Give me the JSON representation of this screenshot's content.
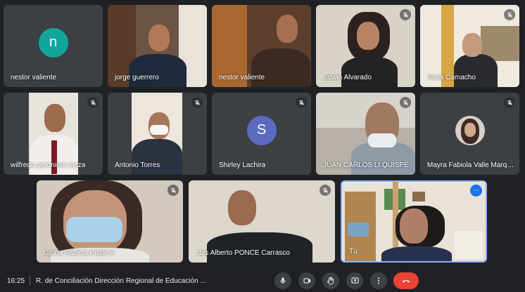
{
  "participants": [
    {
      "name": "nestor valiente",
      "initial": "n",
      "avatar_color": "#12a59c",
      "muted": false,
      "camera": false
    },
    {
      "name": "jorge guerrero",
      "muted": false,
      "camera": true
    },
    {
      "name": "nestor valiente",
      "muted": false,
      "camera": true
    },
    {
      "name": "Edwin Alvarado",
      "muted": true,
      "camera": true
    },
    {
      "name": "Rosa Camacho",
      "muted": true,
      "camera": true
    },
    {
      "name": "wilfredo geronimo meza",
      "muted": true,
      "camera": true
    },
    {
      "name": "Antonio Torres",
      "muted": true,
      "camera": true
    },
    {
      "name": "Shirley Lachira",
      "initial": "S",
      "avatar_color": "#5c6bc0",
      "muted": true,
      "camera": false
    },
    {
      "name": "JUAN CARLOS LI QUISPE",
      "muted": true,
      "camera": true
    },
    {
      "name": "Mayra Fabiola Valle Marqu...",
      "muted": true,
      "camera": false
    },
    {
      "name": "Gloria Patricia Prialé F.",
      "muted": true,
      "camera": true
    },
    {
      "name": "Luis Alberto PONCE Carrasco",
      "muted": true,
      "camera": true
    },
    {
      "name": "Tú",
      "muted": false,
      "camera": true,
      "self": true
    }
  ],
  "bottom_bar": {
    "time": "16:25",
    "separator": "|",
    "meeting_title": "R. de Conciliación Dirección Regional de Educación ...",
    "controls": [
      "microphone-icon",
      "camera-icon",
      "raise-hand-icon",
      "present-icon",
      "more-options-icon",
      "end-call-icon"
    ]
  },
  "colors": {
    "background": "#202124",
    "tile": "#3c4043",
    "end_call": "#ea4335",
    "self_border": "#8ab4f8",
    "accent": "#1a73e8"
  }
}
